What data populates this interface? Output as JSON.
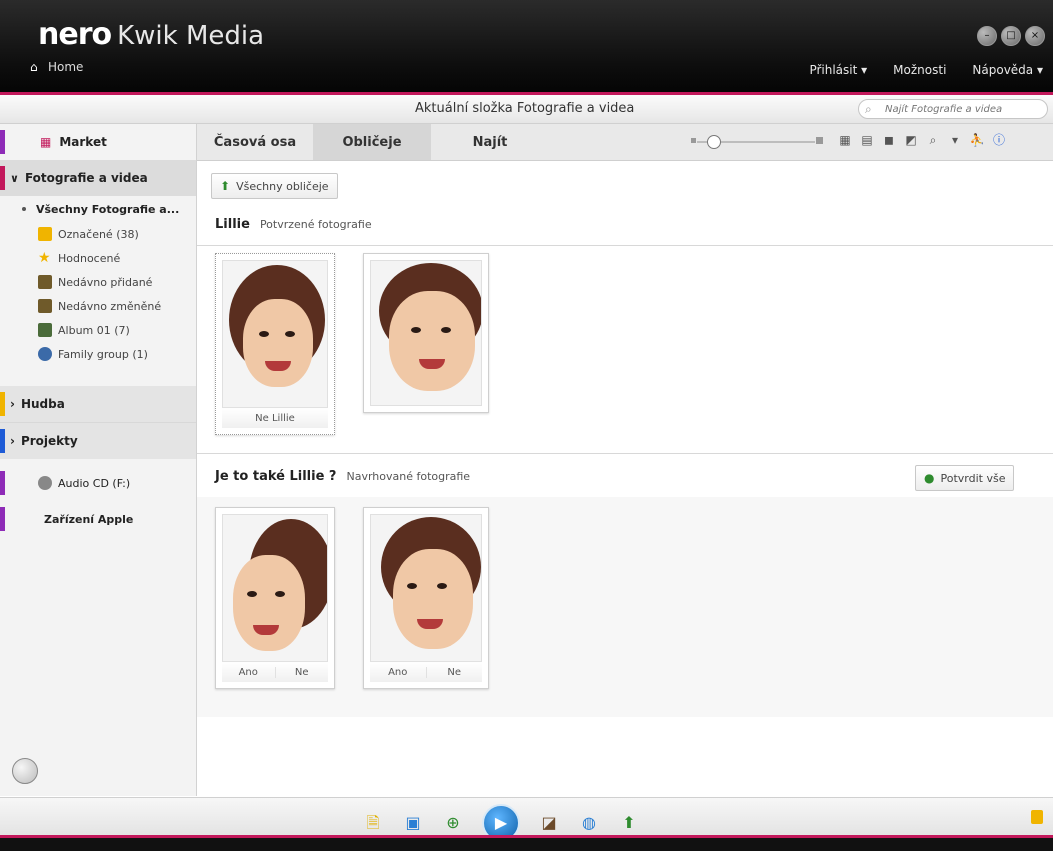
{
  "window": {
    "brand_bold": "nero",
    "brand_rest": "Kwik Media",
    "home_label": "Home",
    "menu": [
      "Přihlásit ▾",
      "Možnosti",
      "Nápověda ▾"
    ],
    "accent": "#c2185b"
  },
  "folderbar": {
    "title": "Aktuální složka Fotografie a videa",
    "search_placeholder": "Najít Fotografie a videa"
  },
  "sidebar": {
    "market": "Market",
    "photos_header": "Fotografie a videa",
    "current": "Všechny Fotografie a...",
    "items": [
      {
        "label": "Označené (38)",
        "icon": "tag-icon"
      },
      {
        "label": "Hodnocené",
        "icon": "star-icon"
      },
      {
        "label": "Nedávno přidané",
        "icon": "clock-icon"
      },
      {
        "label": "Nedávno změněné",
        "icon": "clock-edit-icon"
      },
      {
        "label": "Album 01 (7)",
        "icon": "album-icon"
      },
      {
        "label": "Family group (1)",
        "icon": "group-icon"
      }
    ],
    "music": "Hudba",
    "projects": "Projekty",
    "audio_cd": "Audio CD (F:)",
    "apple": "Zařízení Apple"
  },
  "tabs": [
    {
      "label": "Časová osa"
    },
    {
      "label": "Obličeje",
      "active": true
    },
    {
      "label": "Najít"
    }
  ],
  "content": {
    "all_faces_btn": "Všechny obličeje",
    "person_name": "Lillie",
    "confirmed_sub": "Potvrzené fotografie",
    "confirmed_cards": [
      {
        "caption": "Ne Lillie"
      },
      {
        "caption": ""
      }
    ],
    "suggest_title": "Je to také Lillie ?",
    "suggest_sub": "Navrhované fotografie",
    "confirm_all_btn": "Potvrdit vše",
    "suggested_cards": [
      {
        "yes": "Ano",
        "no": "Ne"
      },
      {
        "yes": "Ano",
        "no": "Ne"
      }
    ]
  },
  "bottom_icons": [
    "import-icon",
    "slideshow-icon",
    "add-icon",
    "play-icon",
    "edit-icon",
    "web-icon",
    "upload-icon"
  ]
}
